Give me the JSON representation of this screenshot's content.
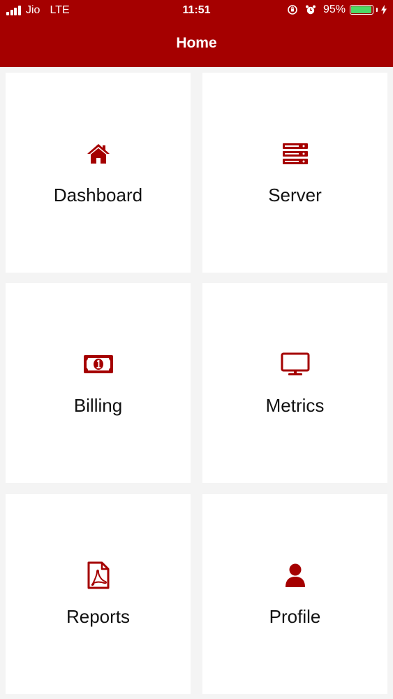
{
  "status_bar": {
    "carrier": "Jio",
    "network": "LTE",
    "time": "11:51",
    "battery_percent": "95%",
    "battery_level": 0.95
  },
  "nav": {
    "title": "Home"
  },
  "tiles": [
    {
      "label": "Dashboard",
      "icon": "home-icon"
    },
    {
      "label": "Server",
      "icon": "server-icon"
    },
    {
      "label": "Billing",
      "icon": "money-bill-icon"
    },
    {
      "label": "Metrics",
      "icon": "desktop-monitor-icon"
    },
    {
      "label": "Reports",
      "icon": "pdf-file-icon"
    },
    {
      "label": "Profile",
      "icon": "user-icon"
    }
  ],
  "colors": {
    "brand": "#a50000",
    "battery": "#4cd964",
    "background": "#f4f4f4",
    "tile": "#ffffff"
  }
}
